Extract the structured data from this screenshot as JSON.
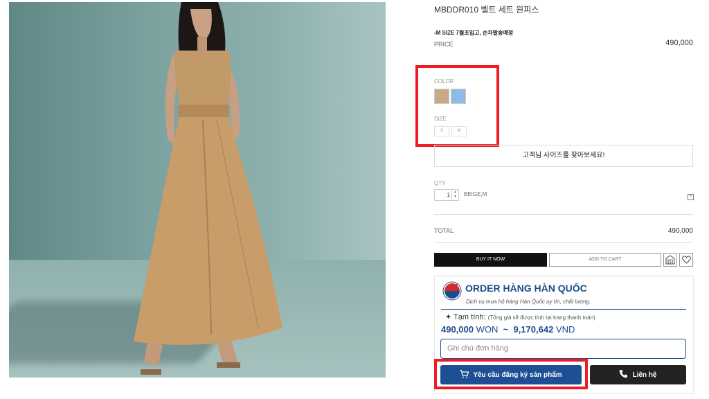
{
  "product": {
    "title": "MBDDR010 벨트 세트 원피스",
    "notice": "-M SIZE 7월초입고, 순차발송예정",
    "price_label": "PRICE",
    "price_value": "490,000",
    "image_alt": "model wearing beige belted sleeveless maxi dress"
  },
  "options": {
    "color_label": "COLOR",
    "colors": [
      {
        "name": "BEIGE",
        "hex": "#c8aa88"
      },
      {
        "name": "BLUE",
        "hex": "#8fb9e6"
      }
    ],
    "size_label": "SIZE",
    "sizes": [
      "S",
      "M"
    ],
    "size_finder": "고객님 사이즈를 찾아보세요!"
  },
  "quantity": {
    "label": "QTY",
    "value": "1",
    "selection": "BEIGE,M",
    "remove_icon": "close-box-icon"
  },
  "total": {
    "label": "TOTAL",
    "value": "490,000"
  },
  "actions": {
    "buy_now": "BUY IT NOW",
    "add_to_cart": "ADD TO CART",
    "store_icon": "store-icon",
    "wish_icon": "heart-icon"
  },
  "order_widget": {
    "brand": "ORDER HÀNG HÀN QUỐC",
    "slogan": "Dịch vụ mua hộ hàng Hàn Quốc uy tín, chất lượng.",
    "estimate_label": "Tạm tính:",
    "estimate_note": "(Tổng giá sẽ được tính tại trang thanh toán)",
    "won_amount": "490,000",
    "won_unit": "WON",
    "tilde": "~",
    "vnd_amount": "9,170,642",
    "vnd_unit": "VND",
    "note_placeholder": "Ghi chú đơn hàng",
    "request_button": "Yêu cầu đăng ký sản phẩm",
    "contact_button": "Liên hệ",
    "accent_color": "#1d4c8e"
  },
  "highlight_color": "#ee1c25"
}
